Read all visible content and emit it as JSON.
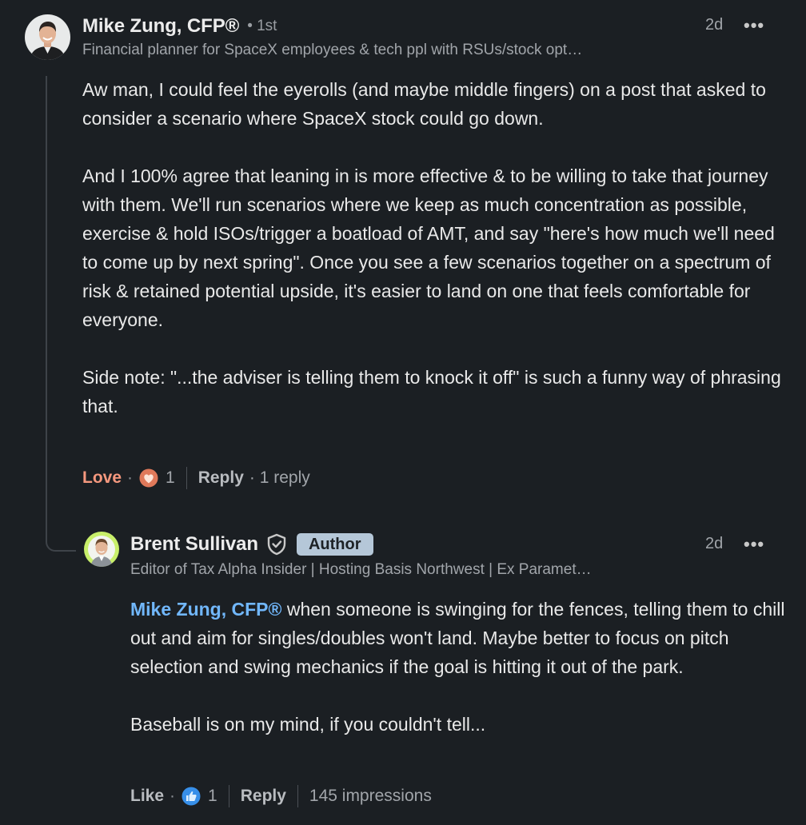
{
  "comment": {
    "author_name": "Mike Zung, CFP®",
    "connection_degree": "• 1st",
    "headline": "Financial planner for SpaceX employees & tech ppl with RSUs/stock opt…",
    "timestamp": "2d",
    "more_label": "•••",
    "paragraphs": [
      "Aw man, I could feel the eyerolls (and maybe middle fingers) on a post that asked to consider a scenario where SpaceX stock could go down.",
      "And I 100% agree that leaning in is more effective & to be willing to take that journey with them. We'll run scenarios where we keep as much concentration as possible, exercise & hold ISOs/trigger a boatload of AMT, and say \"here's how much we'll need to come up by next spring\". Once you see a few scenarios together on a spectrum of risk & retained potential upside, it's easier to land on one that feels comfortable for everyone.",
      "Side note: \"...the adviser is telling them to knock it off\" is such a funny way of phrasing that."
    ],
    "actions": {
      "reaction_label": "Love",
      "dot": "·",
      "reaction_icon": "heart-reaction-icon",
      "reaction_count": "1",
      "reply_label": "Reply",
      "reply_count": "· 1 reply"
    }
  },
  "reply": {
    "author_name": "Brent Sullivan",
    "verified_icon": "shield-check-icon",
    "author_badge": "Author",
    "headline": "Editor of Tax Alpha Insider | Hosting Basis Northwest | Ex Paramet…",
    "timestamp": "2d",
    "more_label": "•••",
    "mention": "Mike Zung, CFP®",
    "paragraph_1_rest": " when someone is swinging for the fences, telling them to chill out and aim for singles/doubles won't land. Maybe better to focus on pitch selection and swing mechanics if the goal is hitting it out of the park.",
    "paragraph_2": "Baseball is on my mind, if you couldn't tell...",
    "actions": {
      "reaction_label": "Like",
      "dot": "·",
      "reaction_icon": "thumbs-up-reaction-icon",
      "reaction_count": "1",
      "reply_label": "Reply",
      "impressions": "145 impressions"
    }
  },
  "colors": {
    "background": "#1b1f23",
    "love_accent": "#f5987e",
    "mention_link": "#71b7fb",
    "like_blue": "#378fe9",
    "author_badge_bg": "#b5c7d8"
  }
}
